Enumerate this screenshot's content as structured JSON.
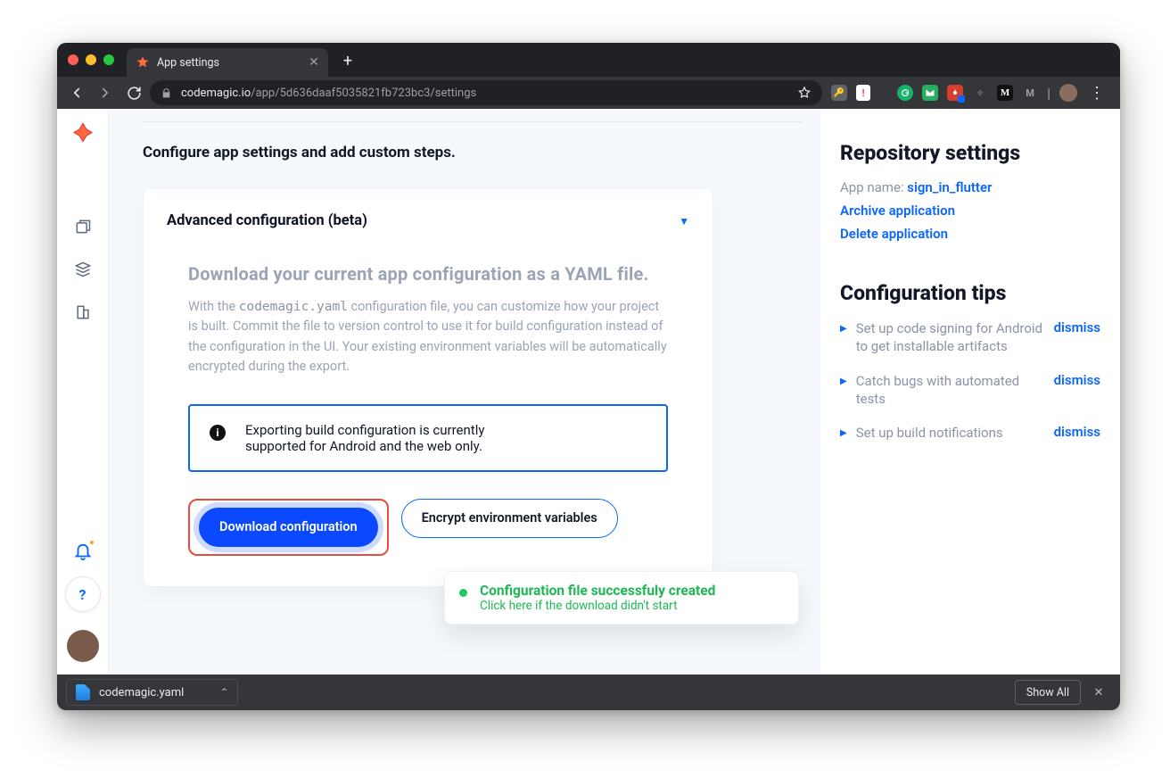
{
  "browser": {
    "tab_title": "App settings",
    "url_host": "codemagic.io",
    "url_path": "/app/5d636daaf5035821fb723bc3/settings"
  },
  "page": {
    "lead": "Configure app settings and add custom steps.",
    "card_title": "Advanced configuration (beta)",
    "section_title": "Download your current app configuration as a YAML file.",
    "section_body_pre": "With the ",
    "section_body_code": "codemagic.yaml",
    "section_body_post": " configuration file, you can customize how your project is built. Commit the file to version control to use it for build configuration instead of the configuration in the UI. Your existing environment variables will be automatically encrypted during the export.",
    "notice": "Exporting build configuration is currently supported for Android and the web only.",
    "btn_download": "Download configuration",
    "btn_encrypt": "Encrypt environment variables"
  },
  "sidebar_right": {
    "repo_heading": "Repository settings",
    "app_name_label": "App name:",
    "app_name_value": "sign_in_flutter",
    "archive_link": "Archive application",
    "delete_link": "Delete application",
    "tips_heading": "Configuration tips",
    "tips": [
      {
        "text": "Set up code signing for Android to get installable artifacts",
        "dismiss": "dismiss"
      },
      {
        "text": "Catch bugs with automated tests",
        "dismiss": "dismiss"
      },
      {
        "text": "Set up build notifications",
        "dismiss": "dismiss"
      }
    ]
  },
  "toast": {
    "title": "Configuration file successfuly created",
    "subtitle": "Click here if the download didn't start"
  },
  "download_bar": {
    "filename": "codemagic.yaml",
    "show_all": "Show All"
  }
}
